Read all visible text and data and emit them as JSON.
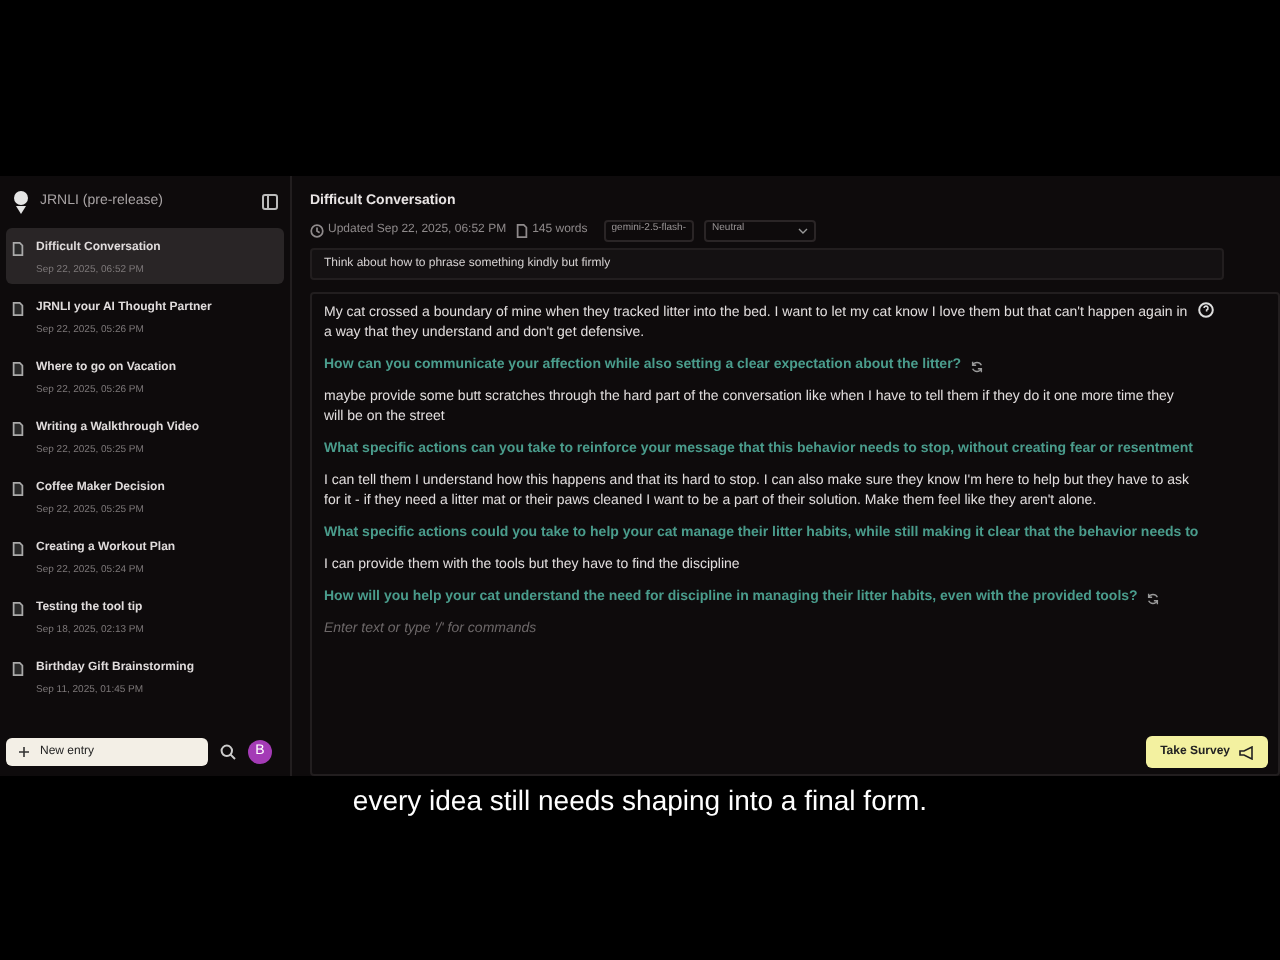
{
  "app": {
    "name": "JRNLI (pre-release)"
  },
  "sidebar": {
    "items": [
      {
        "title": "Difficult Conversation",
        "date": "Sep 22, 2025, 06:52 PM",
        "selected": true
      },
      {
        "title": "JRNLI your AI Thought Partner",
        "date": "Sep 22, 2025, 05:26 PM",
        "selected": false
      },
      {
        "title": "Where to go on Vacation",
        "date": "Sep 22, 2025, 05:26 PM",
        "selected": false
      },
      {
        "title": "Writing a Walkthrough Video",
        "date": "Sep 22, 2025, 05:25 PM",
        "selected": false
      },
      {
        "title": "Coffee Maker Decision",
        "date": "Sep 22, 2025, 05:25 PM",
        "selected": false
      },
      {
        "title": "Creating a Workout Plan",
        "date": "Sep 22, 2025, 05:24 PM",
        "selected": false
      },
      {
        "title": "Testing the tool tip",
        "date": "Sep 18, 2025, 02:13 PM",
        "selected": false
      },
      {
        "title": "Birthday Gift Brainstorming",
        "date": "Sep 11, 2025, 01:45 PM",
        "selected": false
      }
    ],
    "new_entry": "New entry",
    "avatar": "B"
  },
  "entry": {
    "title": "Difficult Conversation",
    "updated": "Updated Sep 22, 2025, 06:52 PM",
    "words": "145 words",
    "model": "gemini-2.5-flash-",
    "tone": "Neutral",
    "prompt": "Think about how to phrase something kindly but firmly",
    "blocks": [
      {
        "kind": "text",
        "text": "My cat crossed a boundary of mine when they tracked litter into the bed. I want to let my cat know I love them but that can't happen again in a way that they understand and don't get defensive."
      },
      {
        "kind": "question",
        "text": "How can you communicate your affection while also setting a clear expectation about the litter?",
        "refresh": true
      },
      {
        "kind": "text",
        "text": "maybe provide some butt scratches through the hard part of the conversation like when I have to tell them if they do it one more time they will be on the street"
      },
      {
        "kind": "question",
        "text": "What specific actions can you take to reinforce your message that this behavior needs to stop, without creating fear or resentment",
        "refresh": false
      },
      {
        "kind": "text",
        "text": "I can tell them I understand how this happens and that its hard to stop. I can also make sure they know I'm here to help but they have to ask for it - if they need a litter mat or their paws cleaned I want to be a part of their solution. Make them feel like they aren't alone."
      },
      {
        "kind": "question",
        "text": "What specific actions could you take to help your cat manage their litter habits, while still making it clear that the behavior needs to",
        "refresh": false
      },
      {
        "kind": "text",
        "text": "I can provide them with the tools but they have to find the discipline"
      },
      {
        "kind": "question",
        "text": "How will you help your cat understand the need for discipline in managing their litter habits, even with the provided tools?",
        "refresh": true
      }
    ],
    "placeholder": "Enter text or type '/' for commands"
  },
  "survey_button": "Take Survey",
  "caption": "every idea still needs shaping into a final form."
}
